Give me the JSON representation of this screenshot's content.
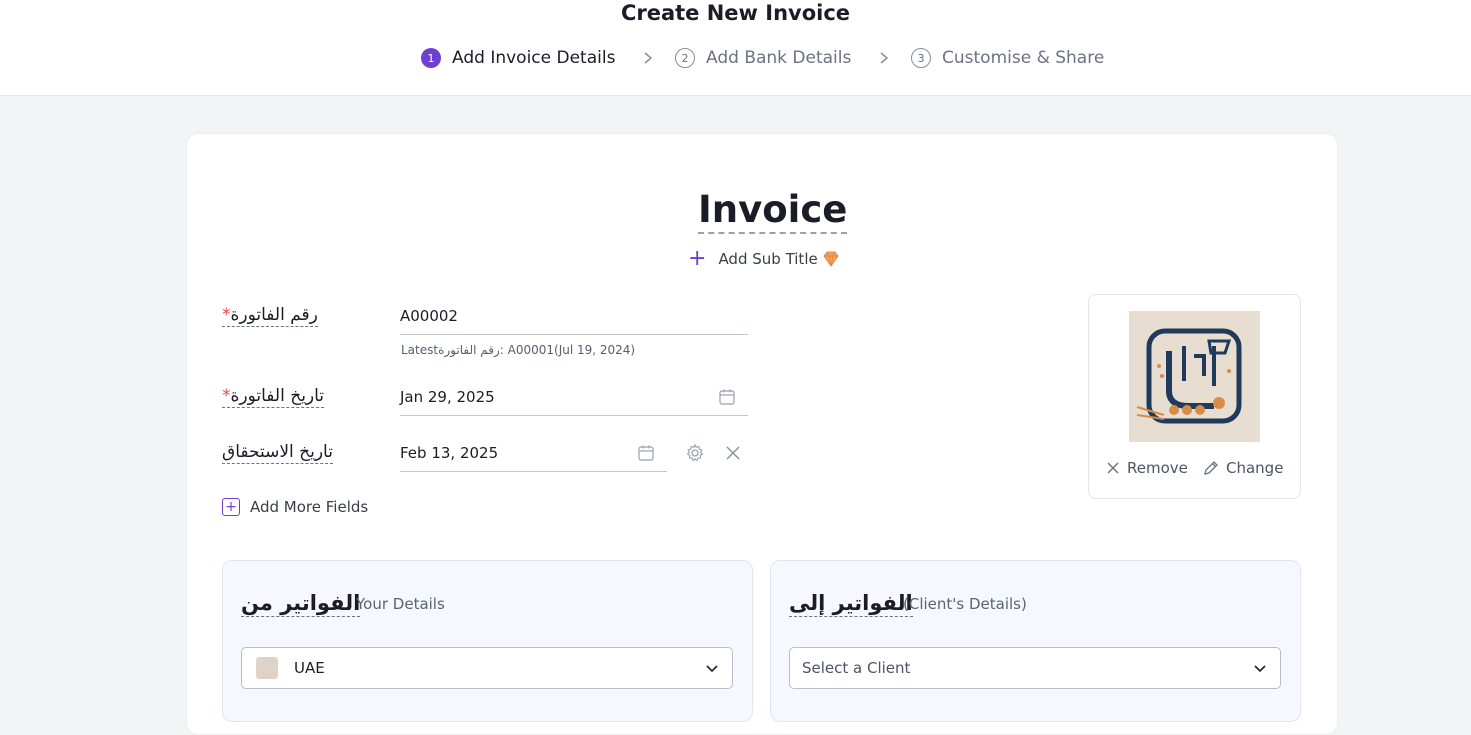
{
  "header": {
    "title": "Create New Invoice",
    "steps": [
      {
        "num": "1",
        "label": "Add Invoice Details"
      },
      {
        "num": "2",
        "label": "Add Bank Details"
      },
      {
        "num": "3",
        "label": "Customise & Share"
      }
    ]
  },
  "invoice": {
    "title": "Invoice",
    "add_subtitle": "Add Sub Title",
    "fields": {
      "number_label": "رقم الفاتورة",
      "number_value": "A00002",
      "number_hint": "Latestرقم الفاتورة: A00001(Jul 19, 2024)",
      "date_label": "تاريخ الفاتورة",
      "date_value": "Jan 29, 2025",
      "due_label": "تاريخ الاستحقاق",
      "due_value": "Feb 13, 2025"
    },
    "required_mark": "*",
    "add_more_fields": "Add More Fields"
  },
  "logo": {
    "remove": "Remove",
    "change": "Change"
  },
  "billed_by": {
    "title": "الفواتير من",
    "subtitle": "Your Details",
    "selected": "UAE"
  },
  "billed_to": {
    "title": "الفواتير إلى",
    "subtitle": "(Client's Details)",
    "placeholder": "Select a Client"
  },
  "colors": {
    "accent": "#6f3fd1",
    "required": "#e5484d",
    "panel_bg": "#f5f8fe"
  }
}
